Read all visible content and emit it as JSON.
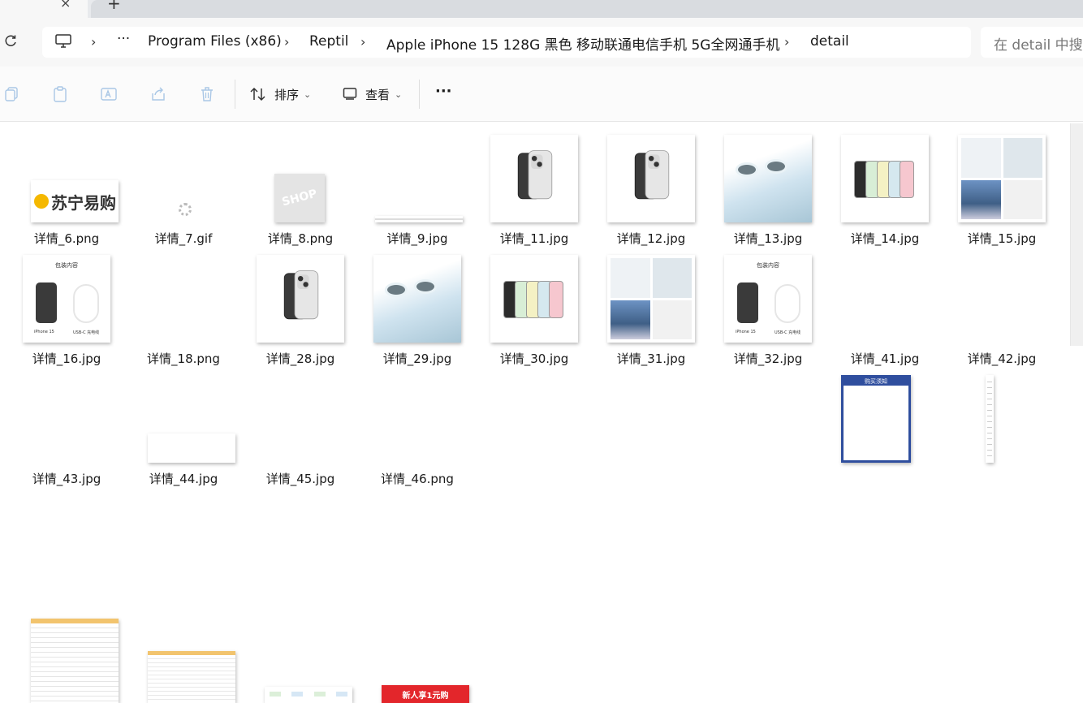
{
  "window": {
    "tab_close": "×",
    "new_tab": "+"
  },
  "address": {
    "refresh_icon": "refresh-icon",
    "crumbs": [
      "Program Files (x86)",
      "Reptil",
      "Apple iPhone 15 128G 黑色 移动联通电信手机 5G全网通手机",
      "detail"
    ],
    "more": "···",
    "search_placeholder": "在 detail 中搜索"
  },
  "toolbar": {
    "sort_label": "排序",
    "view_label": "查看",
    "more_label": "···"
  },
  "files": [
    {
      "name": "详情_6.png",
      "kind": "suning-logo"
    },
    {
      "name": "详情_7.gif",
      "kind": "spinner"
    },
    {
      "name": "详情_8.png",
      "kind": "shop-bag"
    },
    {
      "name": "详情_9.jpg",
      "kind": "thin-strip"
    },
    {
      "name": "详情_11.jpg",
      "kind": "phone-black"
    },
    {
      "name": "详情_12.jpg",
      "kind": "phone-black"
    },
    {
      "name": "详情_13.jpg",
      "kind": "camera-closeup"
    },
    {
      "name": "详情_14.jpg",
      "kind": "phones-colors"
    },
    {
      "name": "详情_15.jpg",
      "kind": "collage"
    },
    {
      "name": "详情_16.jpg",
      "kind": "box-contents"
    },
    {
      "name": "详情_18.png",
      "kind": "blank-wide"
    },
    {
      "name": "详情_28.jpg",
      "kind": "phone-black"
    },
    {
      "name": "详情_29.jpg",
      "kind": "camera-closeup"
    },
    {
      "name": "详情_30.jpg",
      "kind": "phones-colors"
    },
    {
      "name": "详情_31.jpg",
      "kind": "collage"
    },
    {
      "name": "详情_32.jpg",
      "kind": "box-contents"
    },
    {
      "name": "详情_41.jpg",
      "kind": "notice-blue"
    },
    {
      "name": "详情_42.jpg",
      "kind": "tall-strip"
    },
    {
      "name": "详情_43.jpg",
      "kind": "text-doc-tall"
    },
    {
      "name": "详情_44.jpg",
      "kind": "text-doc-wide"
    },
    {
      "name": "详情_45.jpg",
      "kind": "flow-strip"
    },
    {
      "name": "详情_46.png",
      "kind": "promo-banner"
    }
  ],
  "thumb_text": {
    "suning": "苏宁易购",
    "shop": "SHOP",
    "box_title": "包装内容",
    "box_phone": "iPhone 15",
    "box_cable": "USB-C 充电线",
    "notice_title": "购买须知",
    "promo": "新人享1元购"
  }
}
